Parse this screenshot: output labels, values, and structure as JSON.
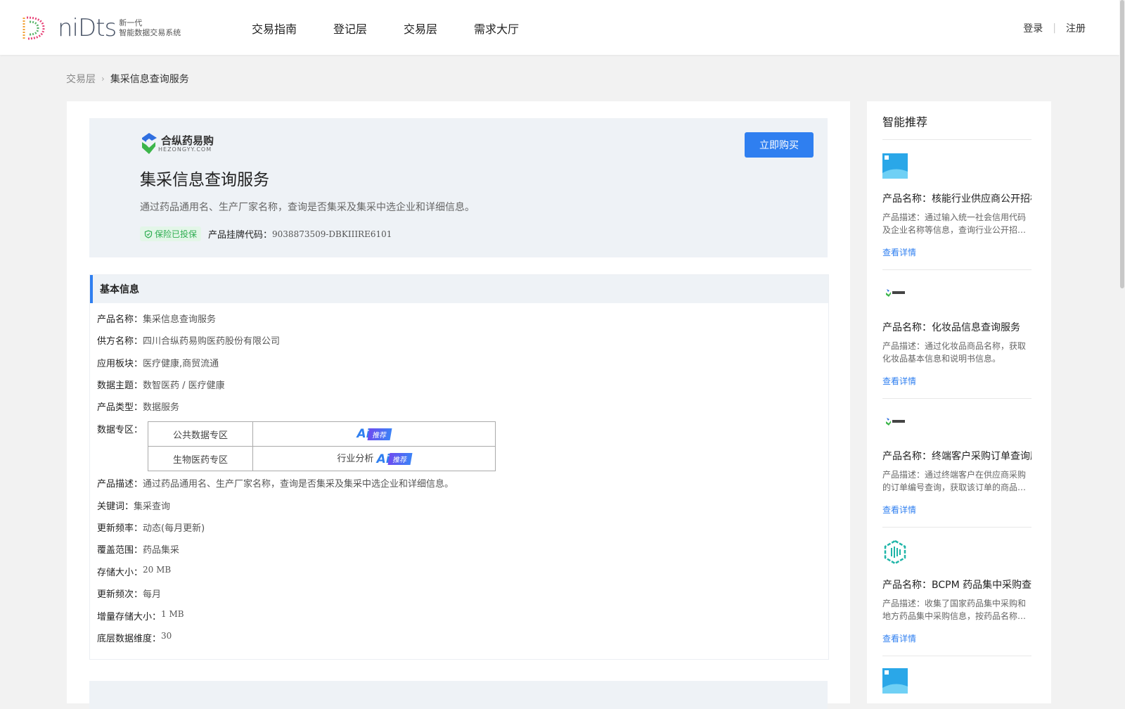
{
  "header": {
    "logo_word": "niDts",
    "logo_sub1": "新一代",
    "logo_sub2": "智能数据交易系统",
    "nav": [
      "交易指南",
      "登记层",
      "交易层",
      "需求大厅"
    ],
    "login": "登录",
    "register": "注册"
  },
  "breadcrumb": {
    "parent": "交易层",
    "current": "集采信息查询服务"
  },
  "product": {
    "brand_name": "合纵药易购",
    "brand_domain": "HEZONGYY.COM",
    "title": "集采信息查询服务",
    "description": "通过药品通用名、生产厂家名称，查询是否集采及集采中选企业和详细信息。",
    "insured_label": "保险已投保",
    "code_label": "产品挂牌代码：",
    "code_value": "9038873509-DBKIIIRE6101",
    "buy_label": "立即购买"
  },
  "basic_info": {
    "heading": "基本信息",
    "product_name": {
      "k": "产品名称：",
      "v": "集采信息查询服务"
    },
    "supplier": {
      "k": "供方名称：",
      "v": "四川合纵药易购医药股份有限公司"
    },
    "sector": {
      "k": "应用板块：",
      "v": "医疗健康,商贸流通"
    },
    "theme": {
      "k": "数据主题：",
      "v": "数智医药 / 医疗健康"
    },
    "type": {
      "k": "产品类型：",
      "v": "数据服务"
    },
    "zone_label": "数据专区：",
    "zones": [
      {
        "name": "公共数据专区",
        "value": "",
        "ai": "Ai",
        "tag": "推荐"
      },
      {
        "name": "生物医药专区",
        "value": "行业分析",
        "ai": "Ai",
        "tag": "推荐"
      }
    ],
    "desc": {
      "k": "产品描述：",
      "v": "通过药品通用名、生产厂家名称，查询是否集采及集采中选企业和详细信息。"
    },
    "keywords": {
      "k": "关键词：",
      "v": "集采查询"
    },
    "update_freq": {
      "k": "更新频率：",
      "v": "动态(每月更新)"
    },
    "coverage": {
      "k": "覆盖范围：",
      "v": "药品集采"
    },
    "storage": {
      "k": "存储大小：",
      "v": "20 MB"
    },
    "update_times": {
      "k": "更新频次：",
      "v": "每月"
    },
    "incr_storage": {
      "k": "增量存储大小：",
      "v": "1 MB"
    },
    "dims": {
      "k": "底层数据维度：",
      "v": "30"
    }
  },
  "sidebar": {
    "title": "智能推荐",
    "items": [
      {
        "name": "产品名称：核能行业供应商公开招标",
        "desc": "产品描述：通过输入统一社会信用代码及企业名称等信息，查询行业公开招…",
        "more": "查看详情"
      },
      {
        "name": "产品名称：化妆品信息查询服务",
        "desc": "产品描述：通过化妆品商品名称，获取化妆品基本信息和说明书信息。",
        "more": "查看详情"
      },
      {
        "name": "产品名称：终端客户采购订单查询服务",
        "desc": "产品描述：通过终端客户在供应商采购的订单编号查询，获取该订单的商品…",
        "more": "查看详情"
      },
      {
        "name": "产品名称：BCPM 药品集中采购查询",
        "desc": "产品描述：收集了国家药品集中采购和地方药品集中采购信息，按药品名称…",
        "more": "查看详情"
      }
    ]
  },
  "colors": {
    "accent": "#2f7ff0",
    "panel_bg": "#eef2f6",
    "green": "#2fae52"
  }
}
